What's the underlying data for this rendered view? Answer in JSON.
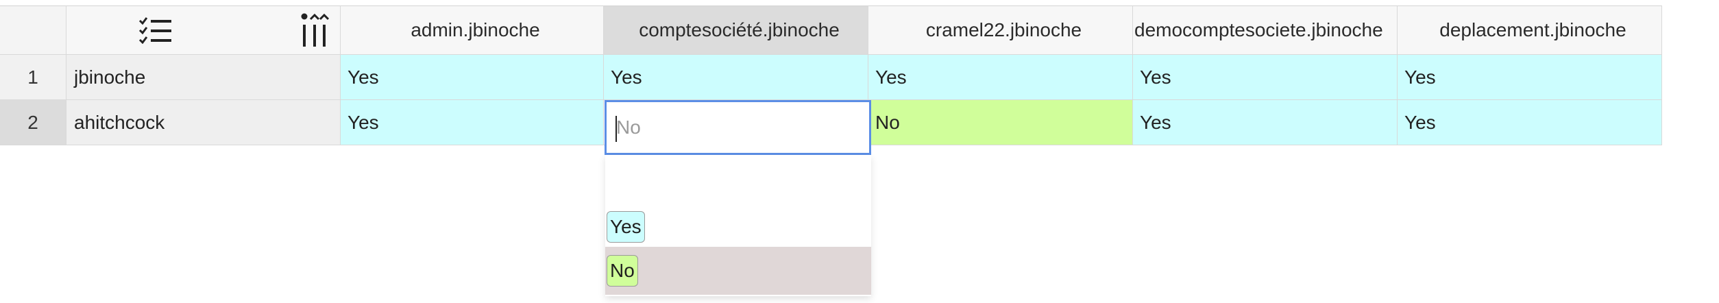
{
  "table": {
    "columns": [
      "admin.jbinoche",
      "comptesociété.jbinoche",
      "cramel22.jbinoche",
      "democomptesociete.jbinoche",
      "deplacement.jbinoche"
    ],
    "rows": [
      {
        "num": "1",
        "name": "jbinoche",
        "values": [
          "Yes",
          "Yes",
          "Yes",
          "Yes",
          "Yes"
        ]
      },
      {
        "num": "2",
        "name": "ahitchcock",
        "values": [
          "Yes",
          "",
          "No",
          "Yes",
          "Yes"
        ]
      }
    ]
  },
  "editor": {
    "placeholder": "No"
  },
  "dropdown": {
    "options": [
      "",
      "Yes",
      "No"
    ],
    "highlighted": "No"
  },
  "colors": {
    "yes": "#ccfdfe",
    "no": "#d0fe9a",
    "editor_border": "#5b8ee6",
    "highlight": "#e0d7d7"
  },
  "icons": {
    "header_left": "checklist-icon",
    "header_right": "column-sort-icon"
  }
}
